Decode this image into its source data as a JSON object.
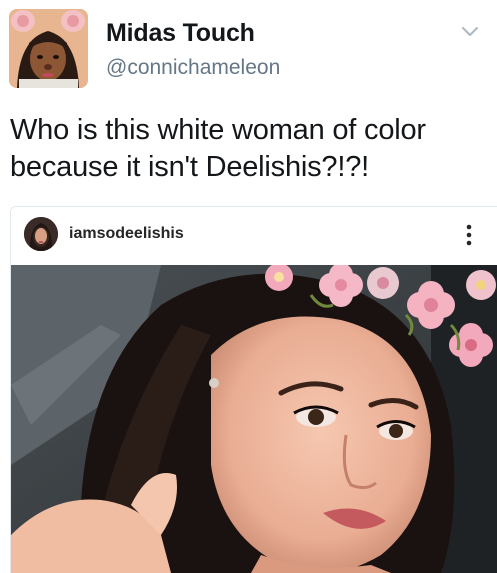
{
  "tweet": {
    "display_name": "Midas Touch",
    "handle": "@connichameleon",
    "text": "Who is this white woman of color because it isn't Deelishis?!?!",
    "menu_icon": "chevron-down-icon"
  },
  "embed": {
    "platform": "instagram",
    "username": "iamsodeelishis",
    "menu_icon": "more-vertical-icon"
  },
  "colors": {
    "primary_text": "#14171a",
    "secondary_text": "#657786",
    "border": "#e1e8ed",
    "ig_text": "#262626"
  }
}
